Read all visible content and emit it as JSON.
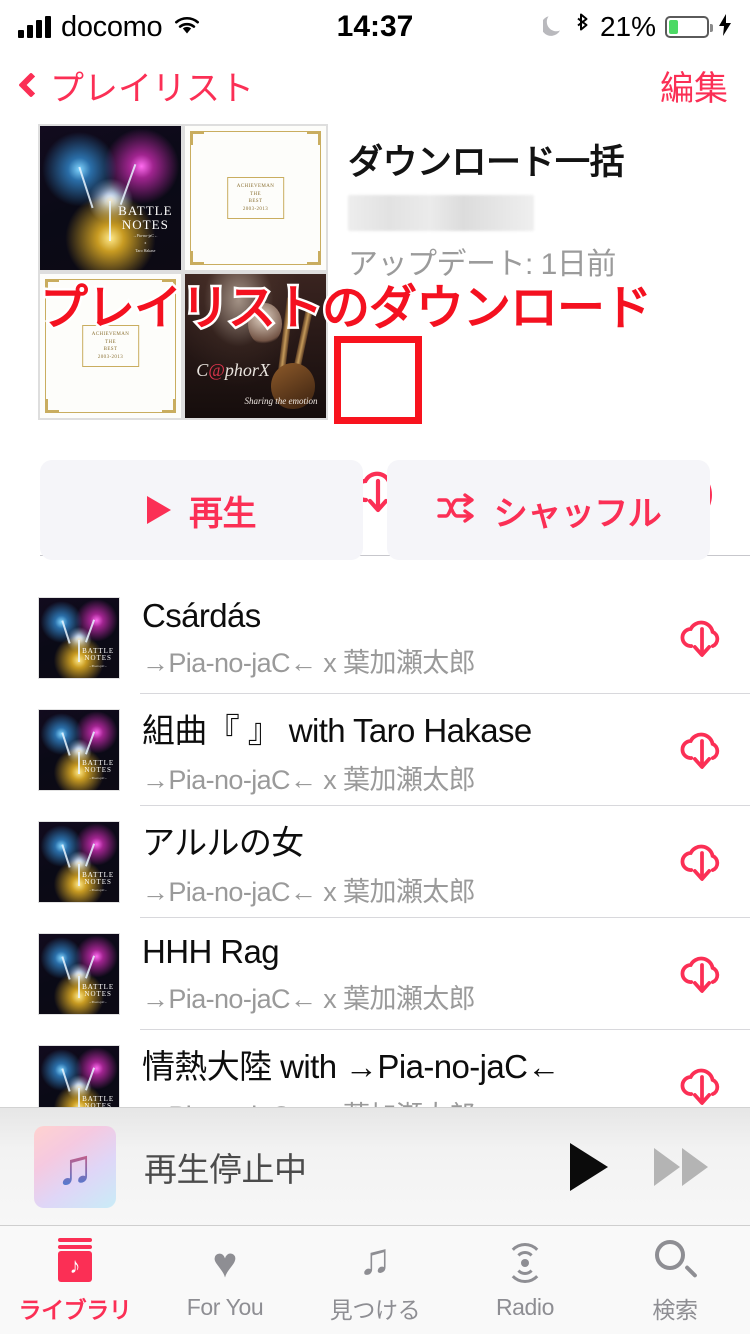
{
  "status_bar": {
    "carrier": "docomo",
    "time": "14:37",
    "battery_percent": "21%",
    "icons": [
      "signal-bars-icon",
      "wifi-icon",
      "do-not-disturb-moon-icon",
      "bluetooth-icon",
      "battery-icon",
      "charging-bolt-icon"
    ]
  },
  "nav_bar": {
    "back_label": "プレイリスト",
    "edit_label": "編集",
    "accent_color": "#fb2f55"
  },
  "header": {
    "title": "ダウンロード一括",
    "author_redacted": "",
    "updated": "アップデート: 1日前",
    "artwork": [
      {
        "name": "BATTLE NOTES",
        "line1": "BATTLE",
        "line2": "NOTES",
        "sub": "→Pia-no-jaC←\nx\nTaro Hakase"
      },
      {
        "name": "ACHIEVEMAN THE BEST 2003-2013",
        "plate": "ACHIEVEMAN\nTHE\nBEST\n2003-2013"
      },
      {
        "name": "ACHIEVEMAN THE BEST 2003-2013",
        "plate": "ACHIEVEMAN\nTHE\nBEST\n2003-2013"
      },
      {
        "name": "Sharing the emotion",
        "logo": "C@phorX",
        "tag": "Sharing the emotion"
      }
    ],
    "download_icon": "cloud-download-icon",
    "more_icon": "more-ellipsis-icon"
  },
  "annotation": {
    "text": "プレイリストのダウンロード",
    "text_color": "#f41120",
    "box_color": "#f8131e"
  },
  "actions": {
    "play_label": "再生",
    "shuffle_label": "シャッフル",
    "play_icon": "play-triangle-icon",
    "shuffle_icon": "shuffle-icon"
  },
  "tracks": [
    {
      "title": "Csárdás",
      "artist": "→Pia-no-jaC← x 葉加瀬太郎",
      "download_icon": "cloud-download-icon"
    },
    {
      "title": "組曲『 』 with Taro Hakase",
      "artist": "→Pia-no-jaC← x 葉加瀬太郎",
      "download_icon": "cloud-download-icon"
    },
    {
      "title": "アルルの女",
      "artist": "→Pia-no-jaC← x 葉加瀬太郎",
      "download_icon": "cloud-download-icon"
    },
    {
      "title": "HHH Rag",
      "artist": "→Pia-no-jaC← x 葉加瀬太郎",
      "download_icon": "cloud-download-icon"
    },
    {
      "title": "情熱大陸 with →Pia-no-jaC←",
      "artist": "→Pia-no-jaC← x 葉加瀬太郎",
      "download_icon": "cloud-download-icon"
    }
  ],
  "mini_player": {
    "status_text": "再生停止中",
    "artwork_icon": "apple-music-note-icon",
    "note_glyph": "♫",
    "play_icon": "play-icon",
    "forward_icon": "fast-forward-icon"
  },
  "tab_bar": {
    "items": [
      {
        "label": "ライブラリ",
        "icon": "library-icon",
        "active": true
      },
      {
        "label": "For You",
        "icon": "heart-icon",
        "active": false
      },
      {
        "label": "見つける",
        "icon": "music-note-icon",
        "active": false
      },
      {
        "label": "Radio",
        "icon": "radio-waves-icon",
        "active": false
      },
      {
        "label": "検索",
        "icon": "search-icon",
        "active": false
      }
    ]
  }
}
